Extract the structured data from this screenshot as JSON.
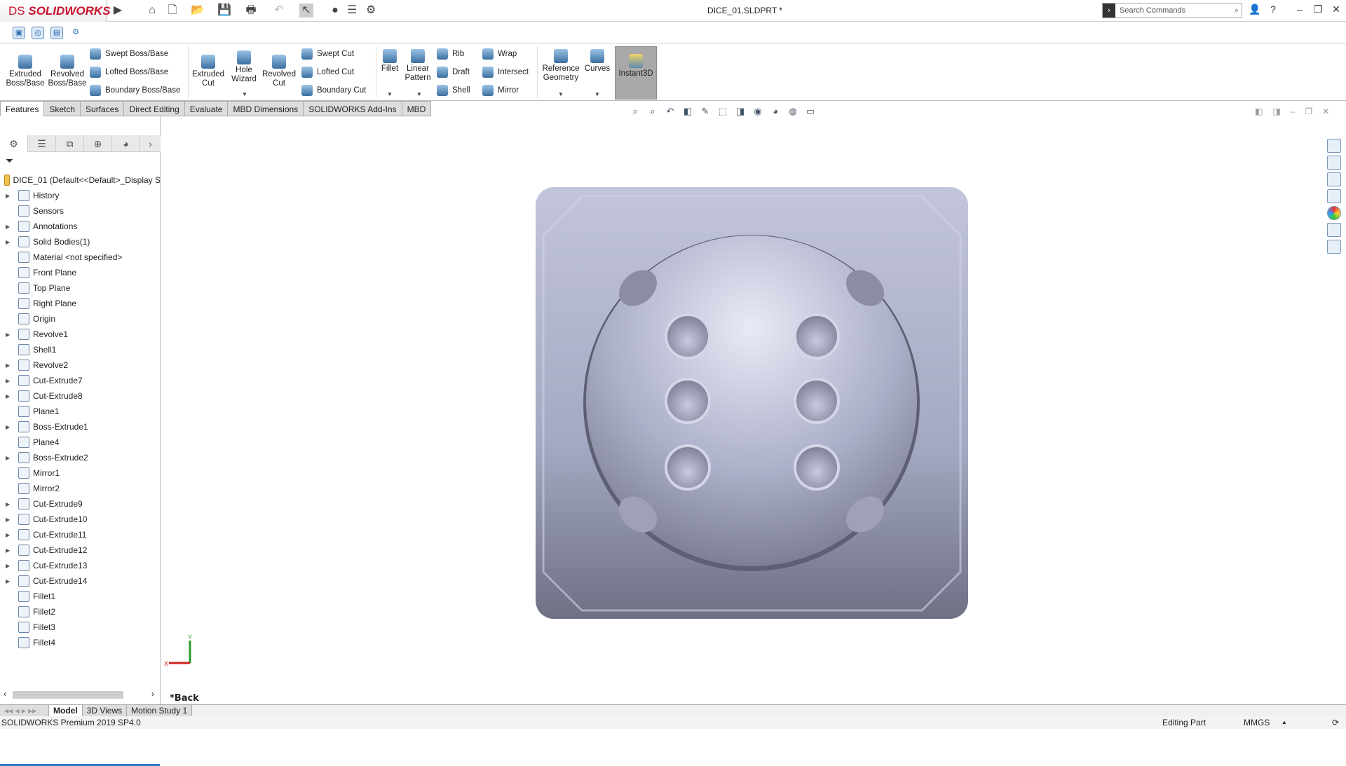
{
  "titlebar": {
    "brand": "SOLIDWORKS",
    "brand_prefix": "DS",
    "doc_title": "DICE_01.SLDPRT *",
    "search_placeholder": "Search Commands"
  },
  "ribbon": {
    "extruded_boss": "Extruded Boss/Base",
    "revolved_boss": "Revolved Boss/Base",
    "swept_boss": "Swept Boss/Base",
    "lofted_boss": "Lofted Boss/Base",
    "boundary_boss": "Boundary Boss/Base",
    "extruded_cut": "Extruded Cut",
    "hole_wizard": "Hole Wizard",
    "revolved_cut": "Revolved Cut",
    "swept_cut": "Swept Cut",
    "lofted_cut": "Lofted Cut",
    "boundary_cut": "Boundary Cut",
    "fillet": "Fillet",
    "linear_pattern": "Linear Pattern",
    "rib": "Rib",
    "draft": "Draft",
    "shell": "Shell",
    "wrap": "Wrap",
    "intersect": "Intersect",
    "mirror": "Mirror",
    "reference_geometry": "Reference Geometry",
    "curves": "Curves",
    "instant3d": "Instant3D"
  },
  "tabs": [
    "Features",
    "Sketch",
    "Surfaces",
    "Direct Editing",
    "Evaluate",
    "MBD Dimensions",
    "SOLIDWORKS Add-Ins",
    "MBD"
  ],
  "tree": {
    "root": "DICE_01  (Default<<Default>_Display S",
    "items": [
      {
        "label": "History",
        "expand": true
      },
      {
        "label": "Sensors",
        "expand": false
      },
      {
        "label": "Annotations",
        "expand": true
      },
      {
        "label": "Solid Bodies(1)",
        "expand": true
      },
      {
        "label": "Material <not specified>",
        "expand": false
      },
      {
        "label": "Front Plane",
        "expand": false
      },
      {
        "label": "Top Plane",
        "expand": false
      },
      {
        "label": "Right Plane",
        "expand": false
      },
      {
        "label": "Origin",
        "expand": false
      },
      {
        "label": "Revolve1",
        "expand": true
      },
      {
        "label": "Shell1",
        "expand": false
      },
      {
        "label": "Revolve2",
        "expand": true
      },
      {
        "label": "Cut-Extrude7",
        "expand": true
      },
      {
        "label": "Cut-Extrude8",
        "expand": true
      },
      {
        "label": "Plane1",
        "expand": false
      },
      {
        "label": "Boss-Extrude1",
        "expand": true
      },
      {
        "label": "Plane4",
        "expand": false
      },
      {
        "label": "Boss-Extrude2",
        "expand": true
      },
      {
        "label": "Mirror1",
        "expand": false
      },
      {
        "label": "Mirror2",
        "expand": false
      },
      {
        "label": "Cut-Extrude9",
        "expand": true
      },
      {
        "label": "Cut-Extrude10",
        "expand": true
      },
      {
        "label": "Cut-Extrude11",
        "expand": true
      },
      {
        "label": "Cut-Extrude12",
        "expand": true
      },
      {
        "label": "Cut-Extrude13",
        "expand": true
      },
      {
        "label": "Cut-Extrude14",
        "expand": true
      },
      {
        "label": "Fillet1",
        "expand": false
      },
      {
        "label": "Fillet2",
        "expand": false
      },
      {
        "label": "Fillet3",
        "expand": false
      },
      {
        "label": "Fillet4",
        "expand": false
      }
    ]
  },
  "viewport": {
    "view_name": "*Back",
    "triad_x": "X",
    "triad_y": "Y"
  },
  "bottom_tabs": [
    "Model",
    "3D Views",
    "Motion Study 1"
  ],
  "status": {
    "product": "SOLIDWORKS Premium 2019 SP4.0",
    "mode": "Editing Part",
    "units": "MMGS"
  },
  "colors": {
    "brand": "#c8102e",
    "part": "#a9adc8",
    "selection_line": "#2b79c2"
  }
}
